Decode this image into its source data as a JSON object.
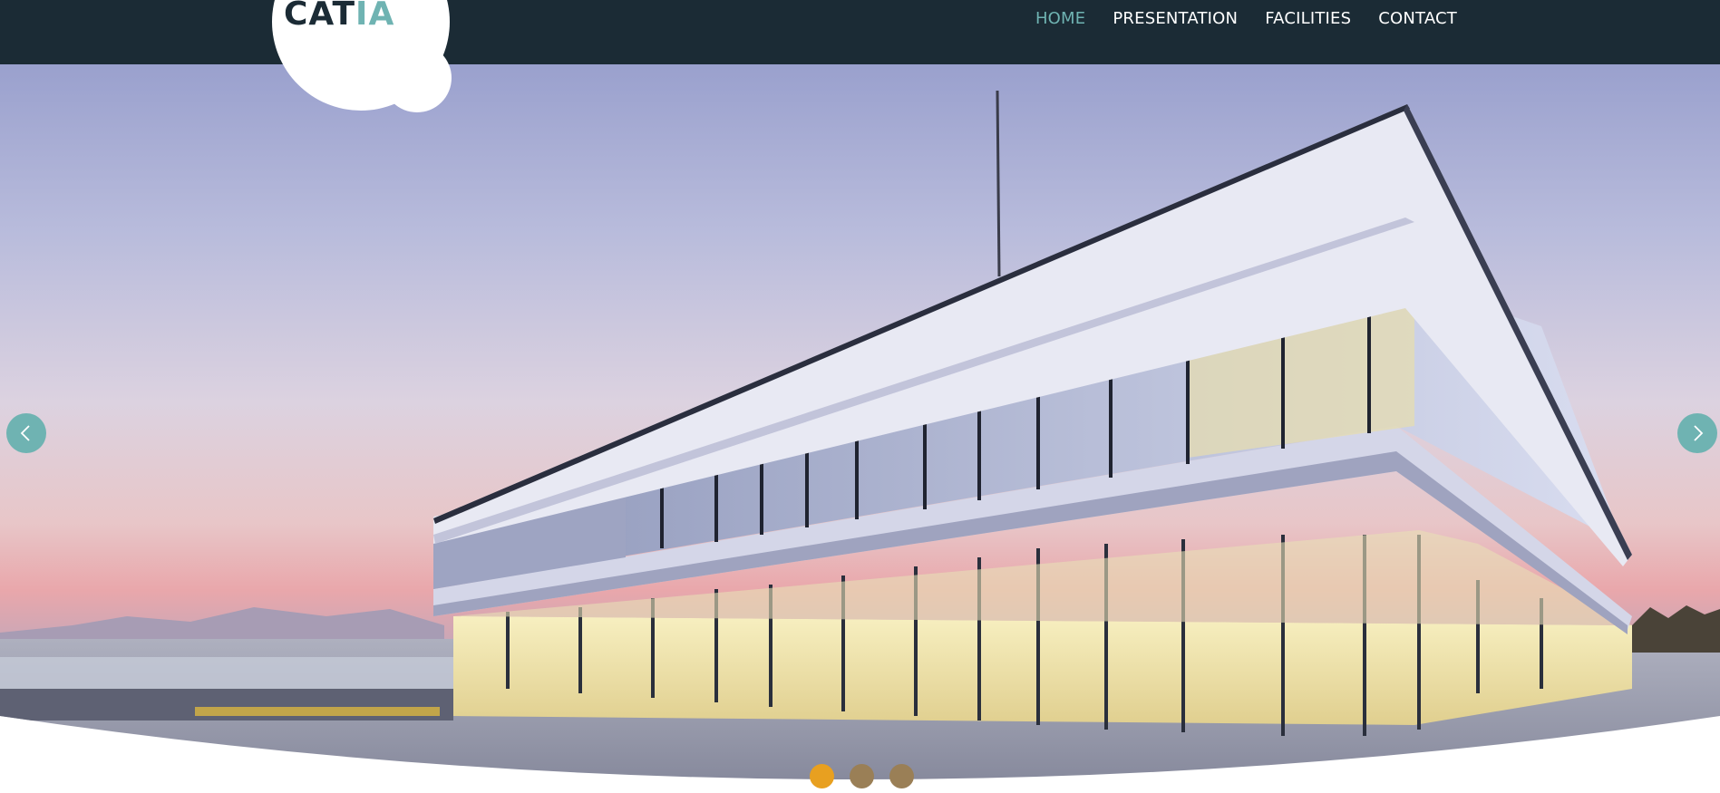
{
  "brand": {
    "logo_part1": "CAT",
    "logo_part2": "IA",
    "colors": {
      "dark": "#1b2b35",
      "accent": "#6fb3b2",
      "dot_active": "#e8a020"
    }
  },
  "nav": {
    "items": [
      {
        "label": "HOME",
        "active": true
      },
      {
        "label": "PRESENTATION",
        "active": false
      },
      {
        "label": "FACILITIES",
        "active": false
      },
      {
        "label": "CONTACT",
        "active": false
      }
    ]
  },
  "slider": {
    "prev_icon": "chevron-left-icon",
    "next_icon": "chevron-right-icon",
    "slide_count": 3,
    "active_slide": 1,
    "dots": [
      {
        "color": "#e8a020"
      },
      {
        "color": "#9a7f56"
      },
      {
        "color": "#9a7f56"
      }
    ]
  }
}
